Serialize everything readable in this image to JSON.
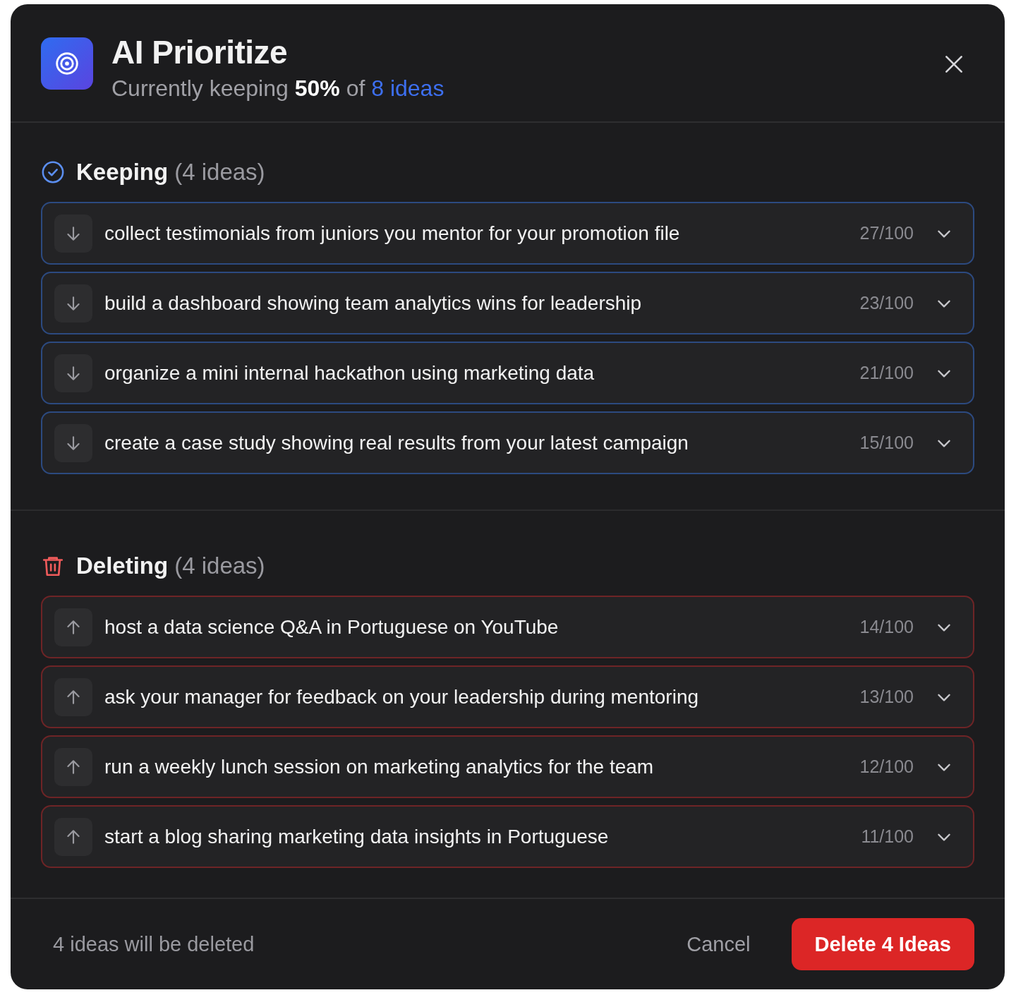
{
  "dialog": {
    "title": "AI Prioritize",
    "subtitle": {
      "text": "Currently keeping **50%** of",
      "highlight": "8 ideas"
    }
  },
  "sections": [
    {
      "kind": "keep",
      "title": "Keeping",
      "count": "(4 ideas)",
      "items": [
        {
          "text": "collect testimonials from juniors you mentor for your promotion file",
          "score": "27/100"
        },
        {
          "text": "build a dashboard showing team analytics wins for leadership",
          "score": "23/100"
        },
        {
          "text": "organize a mini internal hackathon using marketing data",
          "score": "21/100"
        },
        {
          "text": "create a case study showing real results from your latest campaign",
          "score": "15/100"
        }
      ]
    },
    {
      "kind": "delete",
      "title": "Deleting",
      "count": "(4 ideas)",
      "items": [
        {
          "text": "host a data science Q&A in Portuguese on YouTube",
          "score": "14/100"
        },
        {
          "text": "ask your manager for feedback on your leadership during mentoring",
          "score": "13/100"
        },
        {
          "text": "run a weekly lunch session on marketing analytics for the team",
          "score": "12/100"
        },
        {
          "text": "start a blog sharing marketing data insights in Portuguese",
          "score": "11/100"
        }
      ]
    }
  ],
  "footer": {
    "summary": "4 ideas will be deleted",
    "cancel": "Cancel",
    "confirm": "Delete 4 Ideas"
  }
}
